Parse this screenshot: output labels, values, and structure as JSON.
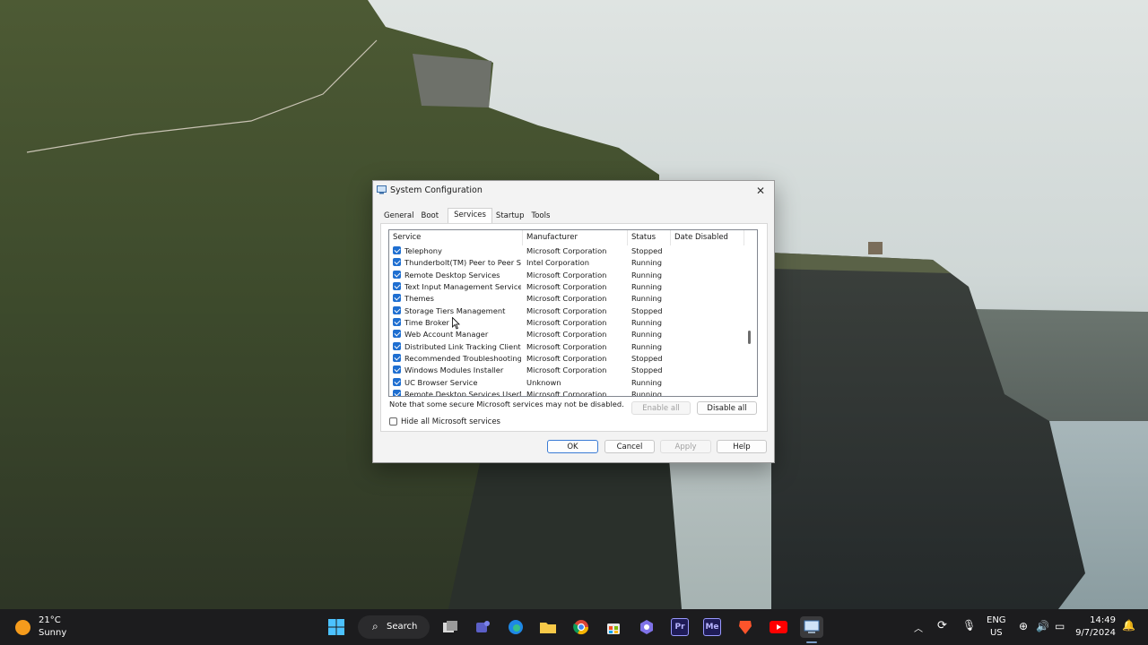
{
  "dialog": {
    "title": "System Configuration",
    "close_label": "✕",
    "tabs": [
      "General",
      "Boot",
      "Services",
      "Startup",
      "Tools"
    ],
    "active_tab": "Services",
    "columns": [
      "Service",
      "Manufacturer",
      "Status",
      "Date Disabled"
    ],
    "rows": [
      {
        "service": "Telephony",
        "manufacturer": "Microsoft Corporation",
        "status": "Stopped",
        "date_disabled": ""
      },
      {
        "service": "Thunderbolt(TM) Peer to Peer S...",
        "manufacturer": "Intel Corporation",
        "status": "Running",
        "date_disabled": ""
      },
      {
        "service": "Remote Desktop Services",
        "manufacturer": "Microsoft Corporation",
        "status": "Running",
        "date_disabled": ""
      },
      {
        "service": "Text Input Management Service",
        "manufacturer": "Microsoft Corporation",
        "status": "Running",
        "date_disabled": ""
      },
      {
        "service": "Themes",
        "manufacturer": "Microsoft Corporation",
        "status": "Running",
        "date_disabled": ""
      },
      {
        "service": "Storage Tiers Management",
        "manufacturer": "Microsoft Corporation",
        "status": "Stopped",
        "date_disabled": ""
      },
      {
        "service": "Time Broker",
        "manufacturer": "Microsoft Corporation",
        "status": "Running",
        "date_disabled": ""
      },
      {
        "service": "Web Account Manager",
        "manufacturer": "Microsoft Corporation",
        "status": "Running",
        "date_disabled": ""
      },
      {
        "service": "Distributed Link Tracking Client",
        "manufacturer": "Microsoft Corporation",
        "status": "Running",
        "date_disabled": ""
      },
      {
        "service": "Recommended Troubleshooting ...",
        "manufacturer": "Microsoft Corporation",
        "status": "Stopped",
        "date_disabled": ""
      },
      {
        "service": "Windows Modules Installer",
        "manufacturer": "Microsoft Corporation",
        "status": "Stopped",
        "date_disabled": ""
      },
      {
        "service": "UC Browser Service",
        "manufacturer": "Unknown",
        "status": "Running",
        "date_disabled": ""
      },
      {
        "service": "Remote Desktop Services UserM...",
        "manufacturer": "Microsoft Corporation",
        "status": "Running",
        "date_disabled": ""
      }
    ],
    "note": "Note that some secure Microsoft services may not be disabled.",
    "enable_all": "Enable all",
    "disable_all": "Disable all",
    "hide_ms": "Hide all Microsoft services",
    "ok": "OK",
    "cancel": "Cancel",
    "apply": "Apply",
    "help": "Help"
  },
  "taskbar": {
    "temperature": "21°C",
    "condition": "Sunny",
    "search_label": "Search",
    "language": "ENG",
    "region": "US",
    "time": "14:49",
    "date": "9/7/2024",
    "pinned": [
      "task-view-icon",
      "teams-icon",
      "edge-icon",
      "file-explorer-icon",
      "chrome-icon",
      "store-icon",
      "copilot-icon",
      "premiere-icon",
      "media-encoder-icon",
      "brave-icon",
      "youtube-icon",
      "system-config-icon"
    ],
    "pinned_labels": {
      "premiere": "Pr",
      "media_encoder": "Me"
    }
  },
  "colors": {
    "accent": "#1f6fd1",
    "taskbar": "#1c1c1e",
    "sun": "#f59b1c"
  }
}
